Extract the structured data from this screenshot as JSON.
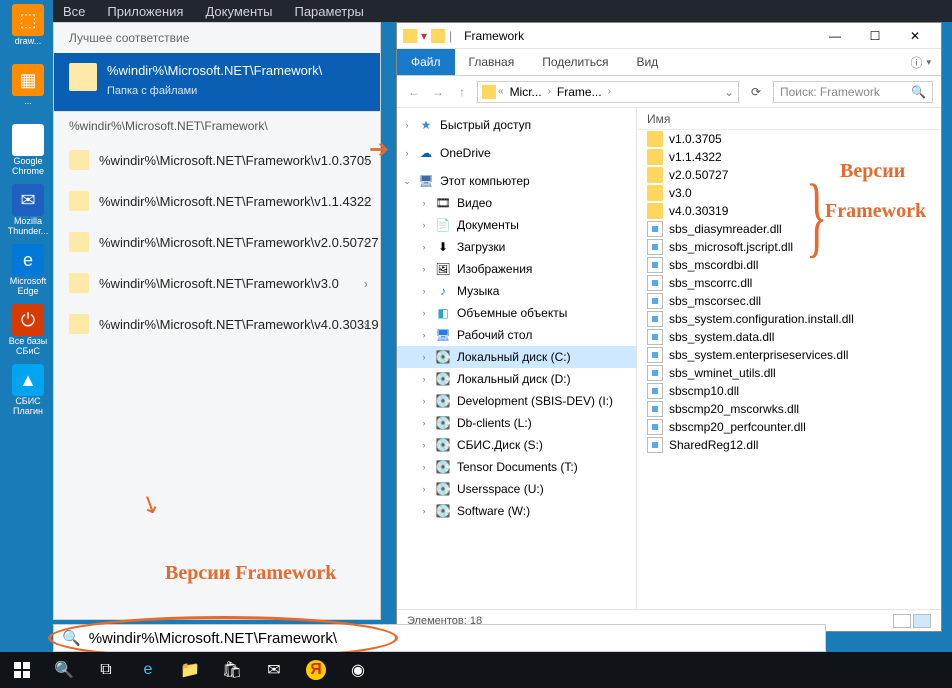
{
  "topbar": {
    "all": "Все",
    "apps": "Приложения",
    "docs": "Документы",
    "params": "Параметры"
  },
  "desktop": [
    {
      "label": "draw..."
    },
    {
      "label": "..."
    },
    {
      "label": "Google Chrome"
    },
    {
      "label": "Mozilla Thunder..."
    },
    {
      "label": "Microsoft Edge"
    },
    {
      "label": "Все базы СБиС"
    },
    {
      "label": "СБИС Плагин"
    }
  ],
  "start": {
    "best_header": "Лучшее соответствие",
    "best_title": "%windir%\\Microsoft.NET\\Framework\\",
    "best_sub": "Папка с файлами",
    "group": "%windir%\\Microsoft.NET\\Framework\\",
    "items": [
      "%windir%\\Microsoft.NET\\Framework\\v1.0.3705",
      "%windir%\\Microsoft.NET\\Framework\\v1.1.4322",
      "%windir%\\Microsoft.NET\\Framework\\v2.0.50727",
      "%windir%\\Microsoft.NET\\Framework\\v3.0",
      "%windir%\\Microsoft.NET\\Framework\\v4.0.30319"
    ]
  },
  "explorer": {
    "title": "Framework",
    "tabs": {
      "file": "Файл",
      "main": "Главная",
      "share": "Поделиться",
      "view": "Вид"
    },
    "crumbs": [
      "Micr...",
      "Frame..."
    ],
    "search_ph": "Поиск: Framework",
    "colname": "Имя",
    "nav": {
      "quick": "Быстрый доступ",
      "onedrive": "OneDrive",
      "thispc": "Этот компьютер",
      "video": "Видео",
      "docs": "Документы",
      "downloads": "Загрузки",
      "pictures": "Изображения",
      "music": "Музыка",
      "3d": "Объемные объекты",
      "desktop": "Рабочий стол",
      "c": "Локальный диск (C:)",
      "d": "Локальный диск (D:)",
      "i": "Development (SBIS-DEV) (I:)",
      "l": "Db-clients (L:)",
      "s": "СБИС.Диск (S:)",
      "t": "Tensor Documents (T:)",
      "u": "Usersspace (U:)",
      "w": "Software (W:)"
    },
    "folders": [
      "v1.0.3705",
      "v1.1.4322",
      "v2.0.50727",
      "v3.0",
      "v4.0.30319"
    ],
    "files": [
      "sbs_diasymreader.dll",
      "sbs_microsoft.jscript.dll",
      "sbs_mscordbi.dll",
      "sbs_mscorrc.dll",
      "sbs_mscorsec.dll",
      "sbs_system.configuration.install.dll",
      "sbs_system.data.dll",
      "sbs_system.enterpriseservices.dll",
      "sbs_wminet_utils.dll",
      "sbscmp10.dll",
      "sbscmp20_mscorwks.dll",
      "sbscmp20_perfcounter.dll",
      "SharedReg12.dll"
    ],
    "status": "Элементов: 18"
  },
  "anno": {
    "left": "Версии Framework",
    "right_l1": "Версии",
    "right_l2": "Framework"
  },
  "search": {
    "value": "%windir%\\Microsoft.NET\\Framework\\"
  }
}
